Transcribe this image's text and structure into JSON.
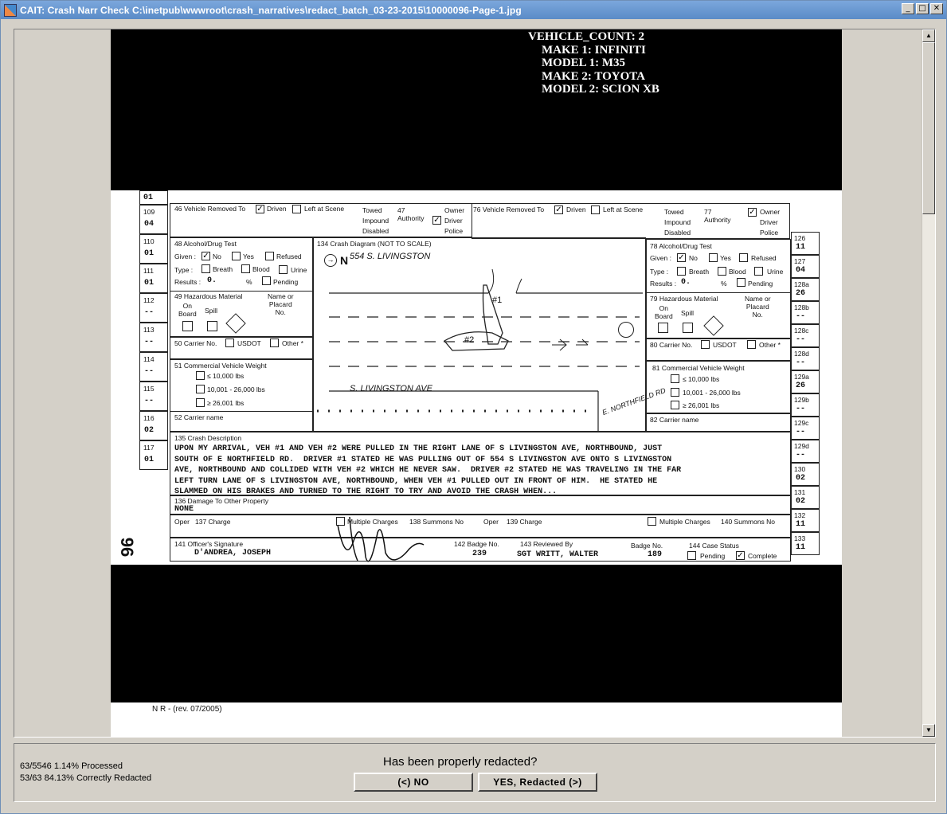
{
  "window": {
    "title": "CAIT: Crash Narr Check C:\\inetpub\\wwwroot\\crash_narratives\\redact_batch_03-23-2015\\10000096-Page-1.jpg",
    "minimize": "_",
    "maximize": "□",
    "close": "✕"
  },
  "vehicle_info": {
    "count": "VEHICLE_COUNT:  2",
    "make1": "MAKE 1:  INFINITI",
    "model1": "MODEL 1:  M35",
    "make2": "MAKE 2:  TOYOTA",
    "model2": "MODEL 2:  SCION XB"
  },
  "form": {
    "left_codes": [
      {
        "code": "109",
        "val": "04"
      },
      {
        "code": "110",
        "val": "01"
      },
      {
        "code": "111",
        "val": "01"
      },
      {
        "code": "112",
        "val": "--"
      },
      {
        "code": "113",
        "val": "--"
      },
      {
        "code": "114",
        "val": "--"
      },
      {
        "code": "115",
        "val": "--"
      },
      {
        "code": "116",
        "val": "02"
      },
      {
        "code": "117",
        "val": "01"
      }
    ],
    "right_codes": [
      {
        "code": "126",
        "val": "11"
      },
      {
        "code": "127",
        "val": "04"
      },
      {
        "code": "128a",
        "val": "26"
      },
      {
        "code": "128b",
        "val": "--"
      },
      {
        "code": "128c",
        "val": "--"
      },
      {
        "code": "128d",
        "val": "--"
      },
      {
        "code": "129a",
        "val": "26"
      },
      {
        "code": "129b",
        "val": "--"
      },
      {
        "code": "129c",
        "val": "--"
      },
      {
        "code": "129d",
        "val": "--"
      },
      {
        "code": "130",
        "val": "02"
      },
      {
        "code": "131",
        "val": "02"
      },
      {
        "code": "132",
        "val": "11"
      },
      {
        "code": "133",
        "val": "11"
      }
    ],
    "top_code": "01",
    "v46_label": "46 Vehicle Removed To",
    "v76_label": "76 Vehicle Removed To",
    "driven": "Driven",
    "left_scene": "Left at Scene",
    "towed": "Towed",
    "impound": "Impound",
    "disabled": "Disabled",
    "authority47": "47\nAuthority",
    "authority77": "77\nAuthority",
    "owner": "Owner",
    "driver": "Driver",
    "police": "Police",
    "alc48": "48 Alcohol/Drug Test",
    "alc78": "78 Alcohol/Drug Test",
    "given": "Given :",
    "no": "No",
    "yes": "Yes",
    "refused": "Refused",
    "type": "Type :",
    "breath": "Breath",
    "blood": "Blood",
    "urine": "Urine",
    "results": "Results :",
    "results_val": "0.",
    "pct": "%",
    "pending": "Pending",
    "haz49": "49 Hazardous Material",
    "haz79": "79 Hazardous Material",
    "on_board": "On\nBoard",
    "spill": "Spill",
    "name_placard": "Name or\nPlacard\nNo.",
    "carrier50": "50 Carrier No.",
    "carrier80": "80 Carrier No.",
    "usdot": "USDOT",
    "other": "Other *",
    "cvw51": "51 Commercial Vehicle Weight",
    "cvw81": "81 Commercial Vehicle Weight",
    "w1": "≤ 10,000 lbs",
    "w2": "10,001 - 26,000 lbs",
    "w3": "≥ 26,001 lbs",
    "carrier52": "52 Carrier name",
    "carrier82": "82 Carrier name",
    "diagram_label": "134 Crash Diagram (NOT TO SCALE)",
    "diag_addr": "554 S. LIVINGSTON",
    "diag_street": "S. LIVINGSTON AVE",
    "diag_rd": "E. NORTHFIELD RD",
    "diag_v1": "#1",
    "diag_v2": "#2",
    "diag_n": "N",
    "desc_label": "135 Crash Description",
    "narrative": "UPON MY ARRIVAL, VEH #1 AND VEH #2 WERE PULLED IN THE RIGHT LANE OF S LIVINGSTON AVE, NORTHBOUND, JUST\nSOUTH OF E NORTHFIELD RD.  DRIVER #1 STATED HE WAS PULLING OUT OF 554 S LIVINGSTON AVE ONTO S LIVINGSTON\nAVE, NORTHBOUND AND COLLIDED WITH VEH #2 WHICH HE NEVER SAW.  DRIVER #2 STATED HE WAS TRAVELING IN THE FAR\nLEFT TURN LANE OF S LIVINGSTON AVE, NORTHBOUND, WHEN VEH #1 PULLED OUT IN FRONT OF HIM.  HE STATED HE\nSLAMMED ON HIS BRAKES AND TURNED TO THE RIGHT TO TRY AND AVOID THE CRASH WHEN...",
    "damage_label": "136 Damage To Other Property",
    "damage_val": "NONE",
    "oper": "Oper",
    "charge137": "137 Charge",
    "multiple_charges": "Multiple Charges",
    "summons138": "138 Summons No",
    "charge139": "139 Charge",
    "summons140": "140 Summons No",
    "officer_sig": "141 Officer's Signature",
    "officer_name": "D'ANDREA, JOSEPH",
    "badge142": "142 Badge No.",
    "badge_val": "239",
    "reviewed143": "143 Reviewed By",
    "reviewer": "SGT WRITT, WALTER",
    "badge_no": "Badge No.",
    "badge_no_val": "189",
    "case144": "144 Case Status",
    "case_pending": "Pending",
    "case_complete": "Complete",
    "side_num": "96",
    "footer": "N  R -   (rev. 07/2005)"
  },
  "status": {
    "processed": "63/5546 1.14% Processed",
    "correct": "53/63 84.13% Correctly Redacted",
    "question": "Has been properly redacted?",
    "no_button": "(<) NO",
    "yes_button": "YES, Redacted (>)"
  }
}
